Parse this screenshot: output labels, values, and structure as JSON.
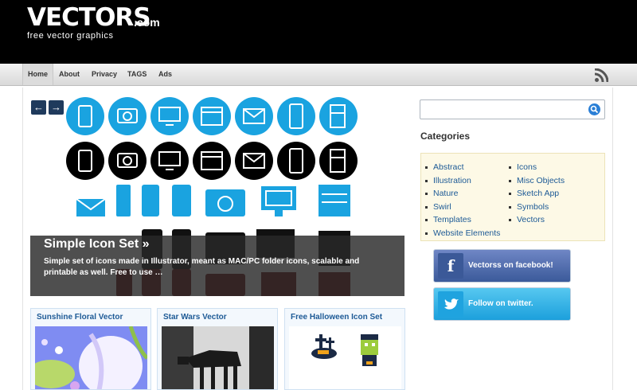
{
  "logo": {
    "main": "VECTORS",
    "domain": ".com",
    "tagline": "free vector graphics"
  },
  "nav": {
    "items": [
      {
        "label": "Home",
        "active": true
      },
      {
        "label": "About",
        "active": false
      },
      {
        "label": "Privacy",
        "active": false
      },
      {
        "label": "TAGS",
        "active": false
      },
      {
        "label": "Ads",
        "active": false
      }
    ]
  },
  "slider": {
    "prev_label": "←",
    "next_label": "→",
    "caption_title": "Simple Icon Set »",
    "caption_text": "Simple set of icons made in Illustrator, meant as MAC/PC folder icons, scalable and printable as well. Free to use …"
  },
  "cards": [
    {
      "title": "Sunshine Floral Vector"
    },
    {
      "title": "Star Wars Vector"
    },
    {
      "title": "Free Halloween Icon Set"
    }
  ],
  "sidebar": {
    "categories_heading": "Categories",
    "categories_left": [
      "Abstract",
      "Illustration",
      "Nature",
      "Swirl",
      "Templates",
      "Website Elements"
    ],
    "categories_right": [
      "Icons",
      "Misc Objects",
      "Sketch App",
      "Symbols",
      "Vectors"
    ],
    "facebook": {
      "label": "Vectorss on facebook!"
    },
    "twitter": {
      "label": "Follow on twitter."
    }
  },
  "icons": {
    "rss": "rss-icon",
    "search": "search-icon",
    "facebook": "facebook-icon",
    "twitter": "twitter-bird-icon"
  },
  "colors": {
    "icon_blue": "#1aa3e0",
    "link": "#1d5a96",
    "header": "#000000"
  }
}
